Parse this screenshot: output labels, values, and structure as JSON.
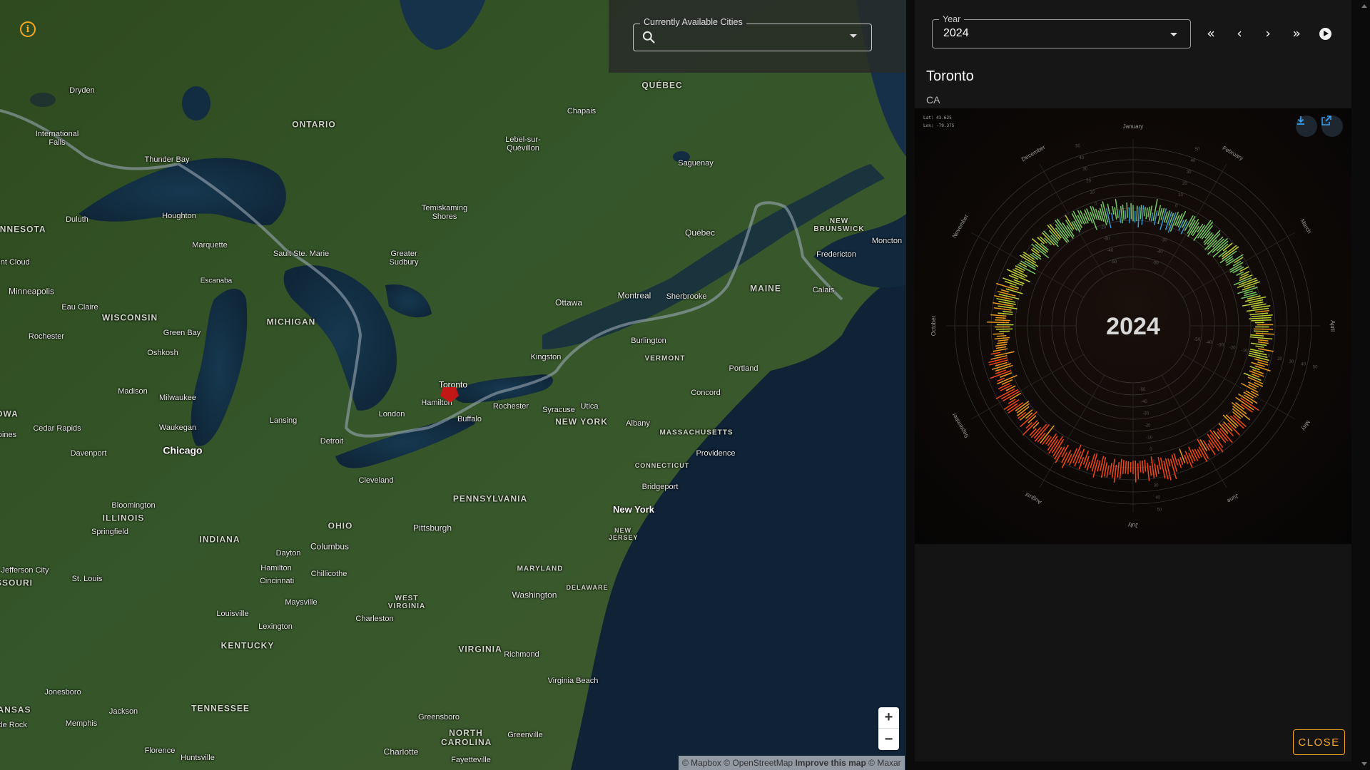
{
  "map": {
    "search": {
      "legend": "Currently Available Cities",
      "value": "",
      "placeholder": ""
    },
    "zoom_in": "+",
    "zoom_out": "−",
    "attribution": {
      "mapbox": "© Mapbox",
      "osm": "© OpenStreetMap",
      "improve": "Improve this map",
      "maxar": "© Maxar"
    },
    "selected_marker": "Toronto",
    "labels": {
      "dryden": "Dryden",
      "intl_falls": "International Falls",
      "thunder_bay": "Thunder Bay",
      "ontario": "ONTARIO",
      "quebec_region": "QUÉBEC",
      "chapais": "Chapais",
      "lebel": "Lebel-sur-Quévillon",
      "saguenay": "Saguenay",
      "minnesota": "INNESOTA",
      "duluth": "Duluth",
      "houghton": "Houghton",
      "marquette": "Marquette",
      "temiskaming": "Temiskaming Shores",
      "quebec_city": "Québec",
      "new_brunswick": "NEW BRUNSWICK",
      "moncton": "Moncton",
      "fredericton": "Fredericton",
      "st_cloud": "int Cloud",
      "sault": "Sault Ste. Marie",
      "greater_sudbury": "Greater Sudbury",
      "escanaba": "Escanaba",
      "minneapolis": "Minneapolis",
      "eau_claire": "Eau Claire",
      "wisconsin": "WISCONSIN",
      "michigan": "MICHIGAN",
      "ottawa": "Ottawa",
      "montreal": "Montreal",
      "sherbrooke": "Sherbrooke",
      "maine": "MAINE",
      "calais": "Calais",
      "rochester_mn": "Rochester",
      "green_bay": "Green Bay",
      "oshkosh": "Oshkosh",
      "burlington": "Burlington",
      "kingston": "Kingston",
      "vermont": "VERMONT",
      "portland": "Portland",
      "toronto": "Toronto",
      "hamilton": "Hamilton",
      "madison": "Madison",
      "milwaukee": "Milwaukee",
      "london": "London",
      "rochester": "Rochester",
      "syracuse": "Syracuse",
      "utica": "Utica",
      "concord": "Concord",
      "iowa": "OWA",
      "lansing": "Lansing",
      "buffalo": "Buffalo",
      "new_york_state": "NEW YORK",
      "albany": "Albany",
      "massachusetts": "MASSACHUSETTS",
      "cedar_rapids": "Cedar Rapids",
      "waukegan": "Waukegan",
      "detroit": "Detroit",
      "providence": "Providence",
      "moines": "oines",
      "davenport": "Davenport",
      "chicago": "Chicago",
      "connecticut": "CONNECTICUT",
      "cleveland": "Cleveland",
      "bridgeport": "Bridgeport",
      "pennsylvania": "PENNSYLVANIA",
      "bloomington": "Bloomington",
      "new_york_city": "New York",
      "illinois": "ILLINOIS",
      "ohio": "OHIO",
      "pittsburgh": "Pittsburgh",
      "springfield": "Springfield",
      "indiana": "INDIANA",
      "new_jersey": "NEW JERSEY",
      "columbus": "Columbus",
      "dayton": "Dayton",
      "maryland": "MARYLAND",
      "jefferson_city": "Jefferson City",
      "hamilton_oh": "Hamilton",
      "missouri": "SSOURI",
      "st_louis": "St. Louis",
      "cincinnati": "Cincinnati",
      "chillicothe": "Chillicothe",
      "delaware": "DELAWARE",
      "washington": "Washington",
      "maysville": "Maysville",
      "west_virginia": "WEST VIRGINIA",
      "louisville": "Louisville",
      "charleston": "Charleston",
      "lexington": "Lexington",
      "kentucky": "KENTUCKY",
      "virginia": "VIRGINIA",
      "richmond": "Richmond",
      "virginia_beach": "Virginia Beach",
      "jonesboro": "Jonesboro",
      "kansas": "ANSAS",
      "tennessee": "TENNESSEE",
      "jackson": "Jackson",
      "greensboro": "Greensboro",
      "little_rock": "tle Rock",
      "memphis": "Memphis",
      "north_carolina": "NORTH CAROLINA",
      "greenville": "Greenville",
      "florence": "Florence",
      "charlotte": "Charlotte",
      "huntsville": "Huntsville",
      "fayetteville": "Fayetteville"
    }
  },
  "panel": {
    "year_legend": "Year",
    "year_value": "2024",
    "nav": {
      "first": "«",
      "prev": "‹",
      "next": "›",
      "last": "»"
    },
    "city_name": "Toronto",
    "country": "CA",
    "lat_text": "Lat: 43.625",
    "lon_text": "Lon: -79.375",
    "close_label": "CLOSE"
  },
  "chart_data": {
    "type": "radial",
    "title": "2024",
    "months": [
      "January",
      "February",
      "March",
      "April",
      "May",
      "June",
      "July",
      "August",
      "September",
      "October",
      "November",
      "December"
    ],
    "ring_labels": [
      "50",
      "40",
      "30",
      "20",
      "10",
      "0",
      "-10",
      "-20",
      "-30",
      "-40",
      "-50"
    ],
    "monthly_avg_temp_c": [
      -4,
      -2,
      3,
      8,
      15,
      21,
      23,
      22,
      19,
      12,
      5,
      0
    ],
    "colors": {
      "cold": "#3a9bdc",
      "cool": "#7dd36a",
      "mild": "#c8dc3c",
      "warm": "#f5a020",
      "hot": "#ff4a1a"
    }
  }
}
